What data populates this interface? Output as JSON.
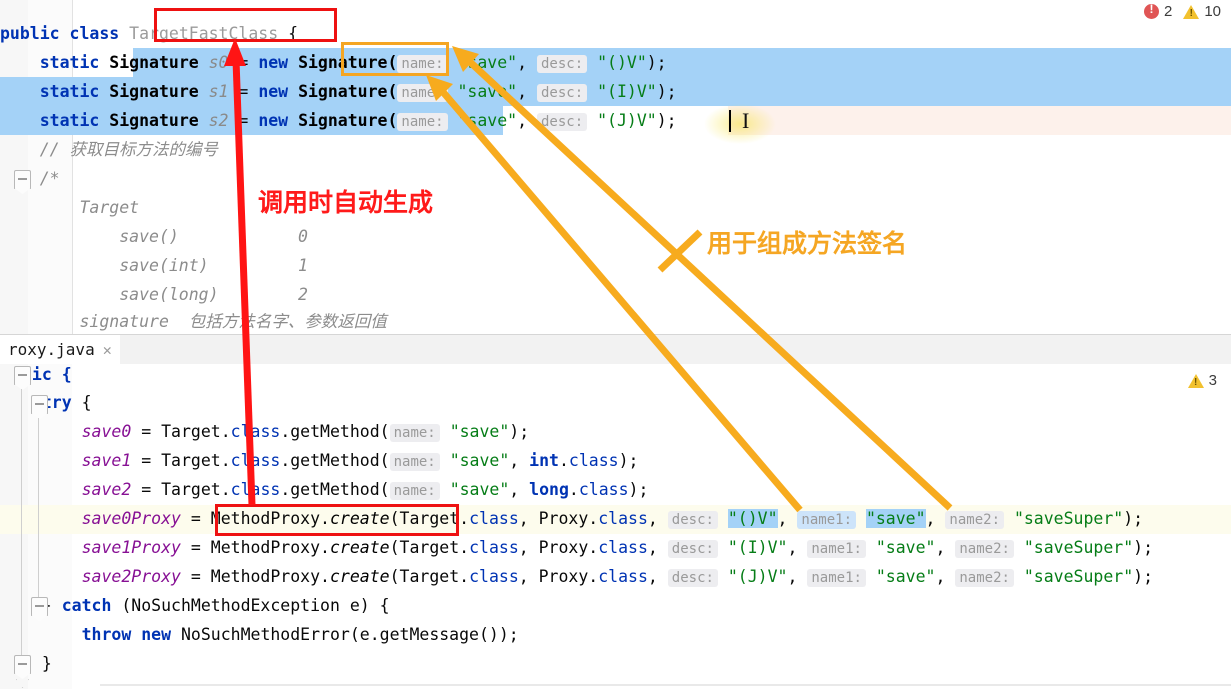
{
  "window": {
    "top_status": {
      "error_icon": "error-circle-icon",
      "error_count": "2",
      "warning_icon": "warning-triangle-icon",
      "warning_count": "10"
    },
    "bottom_status": {
      "warning_icon": "warning-triangle-icon",
      "warning_count": "3"
    }
  },
  "top_editor": {
    "lines": [
      {
        "id": "l1",
        "segments": [
          {
            "t": "public ",
            "c": "kw"
          },
          {
            "t": "class ",
            "c": "kw"
          },
          {
            "t": "TargetFastClass",
            "c": "cls-dim"
          },
          {
            "t": " {",
            "c": "plain"
          }
        ]
      },
      {
        "id": "l2",
        "segments": [
          {
            "t": "    static ",
            "c": "kw"
          },
          {
            "t": "Signature",
            "c": "cls"
          },
          {
            "t": " ",
            "c": "plain"
          },
          {
            "t": "s0",
            "c": "localvar"
          },
          {
            "t": " = ",
            "c": "plain"
          },
          {
            "t": "new ",
            "c": "kw"
          },
          {
            "t": "Signature(",
            "c": "cls"
          },
          {
            "t": "name:",
            "c": "hint"
          },
          {
            "t": " ",
            "c": "plain"
          },
          {
            "t": "\"save\"",
            "c": "str"
          },
          {
            "t": ", ",
            "c": "plain"
          },
          {
            "t": "desc:",
            "c": "hint"
          },
          {
            "t": " ",
            "c": "plain"
          },
          {
            "t": "\"()V\"",
            "c": "str"
          },
          {
            "t": ");",
            "c": "plain"
          }
        ]
      },
      {
        "id": "l3",
        "segments": [
          {
            "t": "    static ",
            "c": "kw"
          },
          {
            "t": "Signature",
            "c": "cls"
          },
          {
            "t": " ",
            "c": "plain"
          },
          {
            "t": "s1",
            "c": "localvar"
          },
          {
            "t": " = ",
            "c": "plain"
          },
          {
            "t": "new ",
            "c": "kw"
          },
          {
            "t": "Signature(",
            "c": "cls"
          },
          {
            "t": "name:",
            "c": "hint"
          },
          {
            "t": " ",
            "c": "plain"
          },
          {
            "t": "\"save\"",
            "c": "str"
          },
          {
            "t": ", ",
            "c": "plain"
          },
          {
            "t": "desc:",
            "c": "hint"
          },
          {
            "t": " ",
            "c": "plain"
          },
          {
            "t": "\"(I)V\"",
            "c": "str"
          },
          {
            "t": ");",
            "c": "plain"
          }
        ]
      },
      {
        "id": "l4",
        "segments": [
          {
            "t": "    static ",
            "c": "kw"
          },
          {
            "t": "Signature",
            "c": "cls"
          },
          {
            "t": " ",
            "c": "plain"
          },
          {
            "t": "s2",
            "c": "localvar"
          },
          {
            "t": " = ",
            "c": "plain"
          },
          {
            "t": "new ",
            "c": "kw"
          },
          {
            "t": "Signature(",
            "c": "cls"
          },
          {
            "t": "name:",
            "c": "hint"
          },
          {
            "t": " ",
            "c": "plain"
          },
          {
            "t": "\"save\"",
            "c": "str"
          },
          {
            "t": ", ",
            "c": "plain"
          },
          {
            "t": "desc:",
            "c": "hint"
          },
          {
            "t": " ",
            "c": "plain"
          },
          {
            "t": "\"(J)V\"",
            "c": "str"
          },
          {
            "t": ");",
            "c": "plain"
          }
        ]
      },
      {
        "id": "l5",
        "segments": [
          {
            "t": "    // 获取目标方法的编号",
            "c": "comment"
          }
        ]
      },
      {
        "id": "l6",
        "segments": [
          {
            "t": "    /*",
            "c": "comment"
          }
        ]
      },
      {
        "id": "l7",
        "segments": [
          {
            "t": "        Target",
            "c": "comment"
          }
        ]
      },
      {
        "id": "l8",
        "segments": [
          {
            "t": "            save()            0",
            "c": "comment"
          }
        ]
      },
      {
        "id": "l9",
        "segments": [
          {
            "t": "            save(int)         1",
            "c": "comment"
          }
        ]
      },
      {
        "id": "l10",
        "segments": [
          {
            "t": "            save(long)        2",
            "c": "comment"
          }
        ]
      },
      {
        "id": "l11",
        "segments": [
          {
            "t": "        signature  包括方法名字、参数返回值",
            "c": "comment"
          }
        ]
      }
    ]
  },
  "tab": {
    "label": "roxy.java",
    "close_icon": "close-icon"
  },
  "bottom_editor": {
    "lines": [
      {
        "id": "b1",
        "segments": [
          {
            "t": "tic {",
            "c": "kw"
          }
        ]
      },
      {
        "id": "b2",
        "segments": [
          {
            "t": "  try ",
            "c": "kw"
          },
          {
            "t": "{",
            "c": "plain"
          }
        ]
      },
      {
        "id": "b3",
        "segments": [
          {
            "t": "      save0",
            "c": "fld"
          },
          {
            "t": " = ",
            "c": "plain"
          },
          {
            "t": "Target",
            "c": "plain"
          },
          {
            "t": ".",
            "c": "plain"
          },
          {
            "t": "class",
            "c": "kw2"
          },
          {
            "t": ".getMethod(",
            "c": "plain"
          },
          {
            "t": "name:",
            "c": "hint"
          },
          {
            "t": " ",
            "c": "plain"
          },
          {
            "t": "\"save\"",
            "c": "str"
          },
          {
            "t": ");",
            "c": "plain"
          }
        ]
      },
      {
        "id": "b4",
        "segments": [
          {
            "t": "      save1",
            "c": "fld"
          },
          {
            "t": " = ",
            "c": "plain"
          },
          {
            "t": "Target",
            "c": "plain"
          },
          {
            "t": ".",
            "c": "plain"
          },
          {
            "t": "class",
            "c": "kw2"
          },
          {
            "t": ".getMethod(",
            "c": "plain"
          },
          {
            "t": "name:",
            "c": "hint"
          },
          {
            "t": " ",
            "c": "plain"
          },
          {
            "t": "\"save\"",
            "c": "str"
          },
          {
            "t": ", ",
            "c": "plain"
          },
          {
            "t": "int",
            "c": "kw"
          },
          {
            "t": ".",
            "c": "plain"
          },
          {
            "t": "class",
            "c": "kw2"
          },
          {
            "t": ");",
            "c": "plain"
          }
        ]
      },
      {
        "id": "b5",
        "segments": [
          {
            "t": "      save2",
            "c": "fld"
          },
          {
            "t": " = ",
            "c": "plain"
          },
          {
            "t": "Target",
            "c": "plain"
          },
          {
            "t": ".",
            "c": "plain"
          },
          {
            "t": "class",
            "c": "kw2"
          },
          {
            "t": ".getMethod(",
            "c": "plain"
          },
          {
            "t": "name:",
            "c": "hint"
          },
          {
            "t": " ",
            "c": "plain"
          },
          {
            "t": "\"save\"",
            "c": "str"
          },
          {
            "t": ", ",
            "c": "plain"
          },
          {
            "t": "long",
            "c": "kw"
          },
          {
            "t": ".",
            "c": "plain"
          },
          {
            "t": "class",
            "c": "kw2"
          },
          {
            "t": ");",
            "c": "plain"
          }
        ]
      },
      {
        "id": "b6",
        "segments": [
          {
            "t": "      save0Proxy",
            "c": "fld"
          },
          {
            "t": " = ",
            "c": "plain"
          },
          {
            "t": "MethodProxy",
            "c": "plain"
          },
          {
            "t": ".",
            "c": "plain"
          },
          {
            "t": "create",
            "c": "mth"
          },
          {
            "t": "(Target",
            "c": "plain"
          },
          {
            "t": ".",
            "c": "plain"
          },
          {
            "t": "class",
            "c": "kw2"
          },
          {
            "t": ", Proxy",
            "c": "plain"
          },
          {
            "t": ".",
            "c": "plain"
          },
          {
            "t": "class",
            "c": "kw2"
          },
          {
            "t": ", ",
            "c": "plain"
          },
          {
            "t": "desc:",
            "c": "hint"
          },
          {
            "t": " ",
            "c": "plain"
          },
          {
            "t": "\"()V\"",
            "c": "str-sel"
          },
          {
            "t": ", ",
            "c": "plain"
          },
          {
            "t": "name1:",
            "c": "hint-sel"
          },
          {
            "t": " ",
            "c": "plain"
          },
          {
            "t": "\"save\"",
            "c": "str-sel"
          },
          {
            "t": ", ",
            "c": "plain"
          },
          {
            "t": "name2:",
            "c": "hint"
          },
          {
            "t": " ",
            "c": "plain"
          },
          {
            "t": "\"saveSuper\"",
            "c": "str"
          },
          {
            "t": ");",
            "c": "plain"
          }
        ]
      },
      {
        "id": "b7",
        "segments": [
          {
            "t": "      save1Proxy",
            "c": "fld"
          },
          {
            "t": " = ",
            "c": "plain"
          },
          {
            "t": "MethodProxy",
            "c": "plain"
          },
          {
            "t": ".",
            "c": "plain"
          },
          {
            "t": "create",
            "c": "mth"
          },
          {
            "t": "(Target",
            "c": "plain"
          },
          {
            "t": ".",
            "c": "plain"
          },
          {
            "t": "class",
            "c": "kw2"
          },
          {
            "t": ", Proxy",
            "c": "plain"
          },
          {
            "t": ".",
            "c": "plain"
          },
          {
            "t": "class",
            "c": "kw2"
          },
          {
            "t": ", ",
            "c": "plain"
          },
          {
            "t": "desc:",
            "c": "hint"
          },
          {
            "t": " ",
            "c": "plain"
          },
          {
            "t": "\"(I)V\"",
            "c": "str"
          },
          {
            "t": ", ",
            "c": "plain"
          },
          {
            "t": "name1:",
            "c": "hint"
          },
          {
            "t": " ",
            "c": "plain"
          },
          {
            "t": "\"save\"",
            "c": "str"
          },
          {
            "t": ", ",
            "c": "plain"
          },
          {
            "t": "name2:",
            "c": "hint"
          },
          {
            "t": " ",
            "c": "plain"
          },
          {
            "t": "\"saveSuper\"",
            "c": "str"
          },
          {
            "t": ");",
            "c": "plain"
          }
        ]
      },
      {
        "id": "b8",
        "segments": [
          {
            "t": "      save2Proxy",
            "c": "fld"
          },
          {
            "t": " = ",
            "c": "plain"
          },
          {
            "t": "MethodProxy",
            "c": "plain"
          },
          {
            "t": ".",
            "c": "plain"
          },
          {
            "t": "create",
            "c": "mth"
          },
          {
            "t": "(Target",
            "c": "plain"
          },
          {
            "t": ".",
            "c": "plain"
          },
          {
            "t": "class",
            "c": "kw2"
          },
          {
            "t": ", Proxy",
            "c": "plain"
          },
          {
            "t": ".",
            "c": "plain"
          },
          {
            "t": "class",
            "c": "kw2"
          },
          {
            "t": ", ",
            "c": "plain"
          },
          {
            "t": "desc:",
            "c": "hint"
          },
          {
            "t": " ",
            "c": "plain"
          },
          {
            "t": "\"(J)V\"",
            "c": "str"
          },
          {
            "t": ", ",
            "c": "plain"
          },
          {
            "t": "name1:",
            "c": "hint"
          },
          {
            "t": " ",
            "c": "plain"
          },
          {
            "t": "\"save\"",
            "c": "str"
          },
          {
            "t": ", ",
            "c": "plain"
          },
          {
            "t": "name2:",
            "c": "hint"
          },
          {
            "t": " ",
            "c": "plain"
          },
          {
            "t": "\"saveSuper\"",
            "c": "str"
          },
          {
            "t": ");",
            "c": "plain"
          }
        ]
      },
      {
        "id": "b9",
        "segments": [
          {
            "t": "  } ",
            "c": "plain"
          },
          {
            "t": "catch ",
            "c": "kw"
          },
          {
            "t": "(NoSuchMethodException e) {",
            "c": "plain"
          }
        ]
      },
      {
        "id": "b10",
        "segments": [
          {
            "t": "      throw ",
            "c": "kw"
          },
          {
            "t": "new ",
            "c": "kw"
          },
          {
            "t": "NoSuchMethodError(e.getMessage());",
            "c": "plain"
          }
        ]
      },
      {
        "id": "b11",
        "segments": [
          {
            "t": "  }",
            "c": "plain"
          }
        ]
      }
    ]
  },
  "annotations": {
    "red_note": "调用时自动生成",
    "orange_note": "用于组成方法签名",
    "red_box_class": "TargetFastClass",
    "orange_box_signature": "Signature(",
    "red_box_methodproxy": "MethodProxy.create(Target.class"
  },
  "colors": {
    "red": "#ee1111",
    "orange": "#f5a623",
    "selection_blue": "#a4d2f7",
    "pink_row": "#fdf1eb",
    "string_green": "#067d17",
    "keyword_blue": "#0033b3",
    "field_purple": "#871094"
  }
}
